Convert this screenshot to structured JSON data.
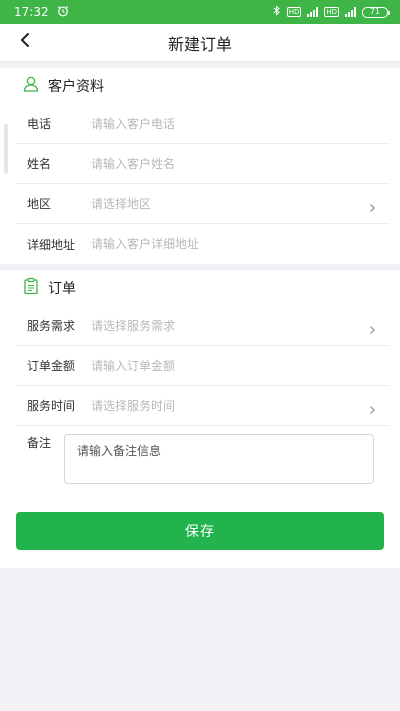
{
  "status_bar": {
    "time": "17:32",
    "battery": "71"
  },
  "nav": {
    "title": "新建订单"
  },
  "customer": {
    "title": "客户资料",
    "fields": [
      {
        "label": "电话",
        "placeholder": "请输入客户电话"
      },
      {
        "label": "姓名",
        "placeholder": "请输入客户姓名"
      },
      {
        "label": "地区",
        "placeholder": "请选择地区"
      },
      {
        "label": "详细地址",
        "placeholder": "请输入客户详细地址"
      }
    ]
  },
  "order": {
    "title": "订单",
    "fields": [
      {
        "label": "服务需求",
        "placeholder": "请选择服务需求"
      },
      {
        "label": "订单金额",
        "placeholder": "请输入订单金额"
      },
      {
        "label": "服务时间",
        "placeholder": "请选择服务时间"
      }
    ],
    "remark_label": "备注",
    "remark_placeholder": "请输入备注信息"
  },
  "actions": {
    "save_label": "保存"
  },
  "colors": {
    "status_bar": "#3fb548",
    "accent": "#22b34c",
    "background": "#f2f2f6"
  },
  "icons": {
    "back": "chevron-left-icon",
    "customer": "user-icon",
    "order": "clipboard-icon",
    "select": "chevron-right-icon"
  }
}
